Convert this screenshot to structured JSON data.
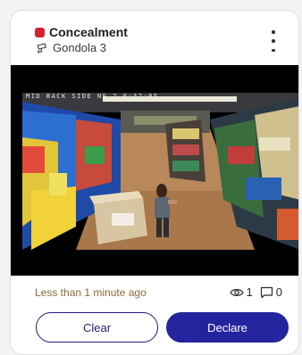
{
  "alert": {
    "title": "Concealment",
    "location": "Gondola 3",
    "severity_color": "#d3232f"
  },
  "video": {
    "osd_text": "MID BACK SIDE NE 2    0:42:05"
  },
  "footer": {
    "time_ago": "Less than 1 minute ago",
    "views": "1",
    "comments": "0"
  },
  "actions": {
    "clear_label": "Clear",
    "declare_label": "Declare"
  },
  "icons": {
    "more": "more-vertical-icon",
    "camera": "camera-icon",
    "views": "eye-icon",
    "comments": "comment-icon"
  }
}
